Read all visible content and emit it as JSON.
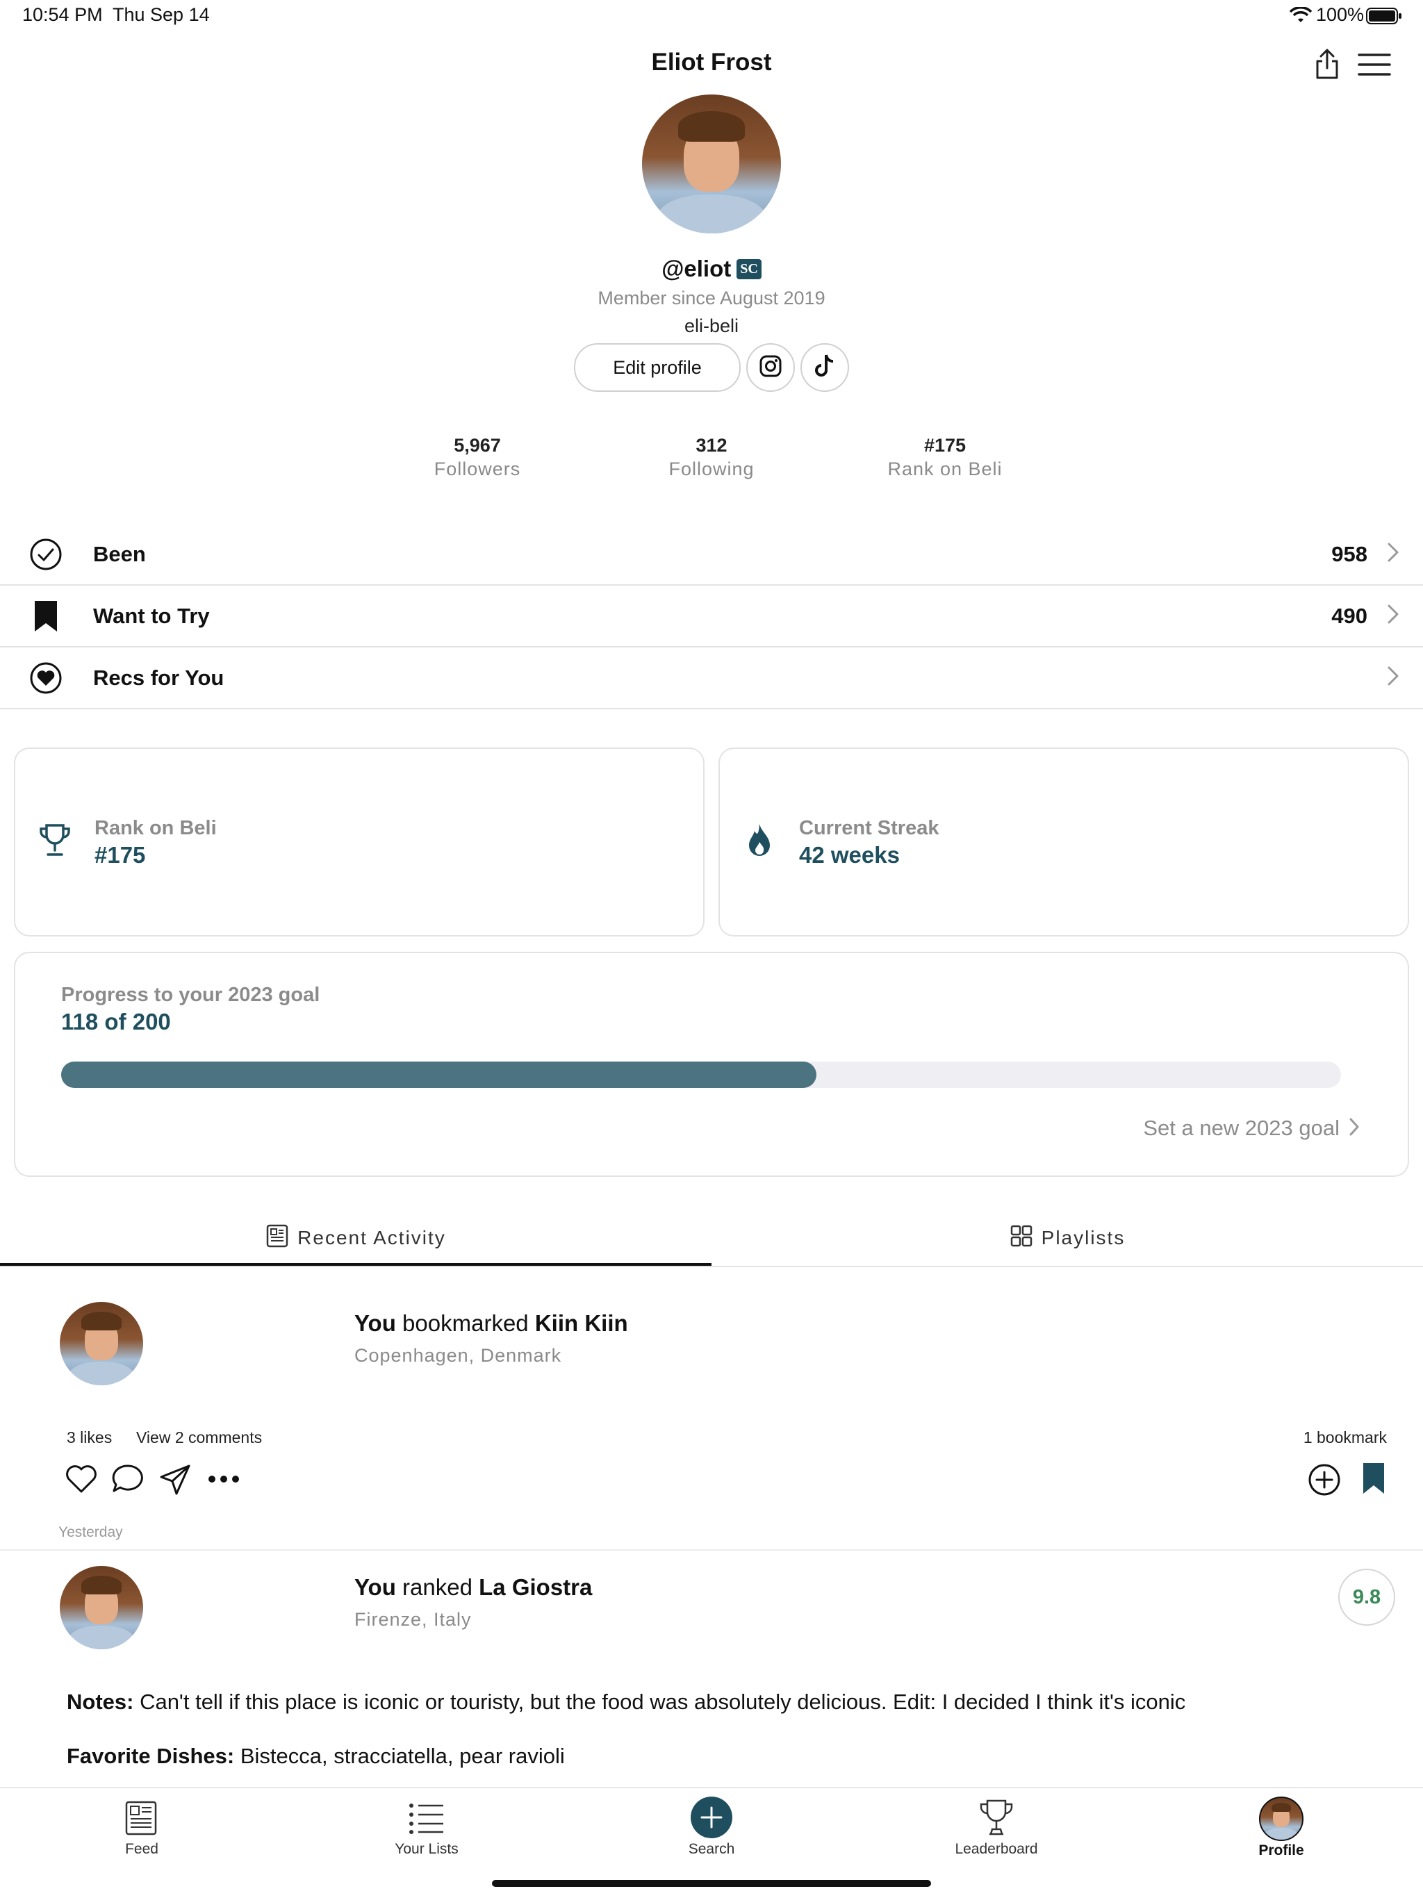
{
  "status_bar": {
    "time": "10:54 PM",
    "date": "Thu Sep 14",
    "battery": "100%"
  },
  "header": {
    "title": "Eliot Frost"
  },
  "profile": {
    "username": "@eliot",
    "badge": "SC",
    "member_since": "Member since August 2019",
    "handle": "eli-beli",
    "edit_label": "Edit profile"
  },
  "stats": [
    {
      "value": "5,967",
      "label": "Followers"
    },
    {
      "value": "312",
      "label": "Following"
    },
    {
      "value": "#175",
      "label": "Rank on Beli"
    }
  ],
  "lists": [
    {
      "label": "Been",
      "count": "958"
    },
    {
      "label": "Want to Try",
      "count": "490"
    },
    {
      "label": "Recs for You",
      "count": ""
    }
  ],
  "cards": {
    "rank": {
      "label": "Rank on Beli",
      "value": "#175"
    },
    "streak": {
      "label": "Current Streak",
      "value": "42 weeks"
    }
  },
  "goal": {
    "label": "Progress to your 2023 goal",
    "value": "118 of 200",
    "progress": 0.59,
    "link": "Set a new 2023 goal"
  },
  "tabs": [
    {
      "label": "Recent Activity"
    },
    {
      "label": "Playlists"
    }
  ],
  "colors": {
    "accent": "#1f4f5e",
    "progress": "#4c7380",
    "score": "#3c8a5a"
  },
  "feed": [
    {
      "prefix": "You",
      "verb": " bookmarked ",
      "place": "Kiin Kiin",
      "location": "Copenhagen, Denmark",
      "likes": "3 likes",
      "comments": "View 2 comments",
      "bookmarks": "1 bookmark",
      "time": "Yesterday"
    },
    {
      "prefix": "You",
      "verb": " ranked ",
      "place": "La Giostra",
      "location": "Firenze, Italy",
      "score": "9.8",
      "notes_label": "Notes:",
      "notes": " Can't tell if this place is iconic or touristy, but the food was absolutely delicious. Edit: I decided I think it's iconic",
      "dishes_label": "Favorite Dishes:",
      "dishes": " Bistecca, stracciatella, pear ravioli"
    }
  ],
  "nav": [
    {
      "label": "Feed",
      "icon": "feed-icon"
    },
    {
      "label": "Your Lists",
      "icon": "list-icon"
    },
    {
      "label": "Search",
      "icon": "plus-icon"
    },
    {
      "label": "Leaderboard",
      "icon": "trophy-icon"
    },
    {
      "label": "Profile",
      "icon": "avatar"
    }
  ]
}
